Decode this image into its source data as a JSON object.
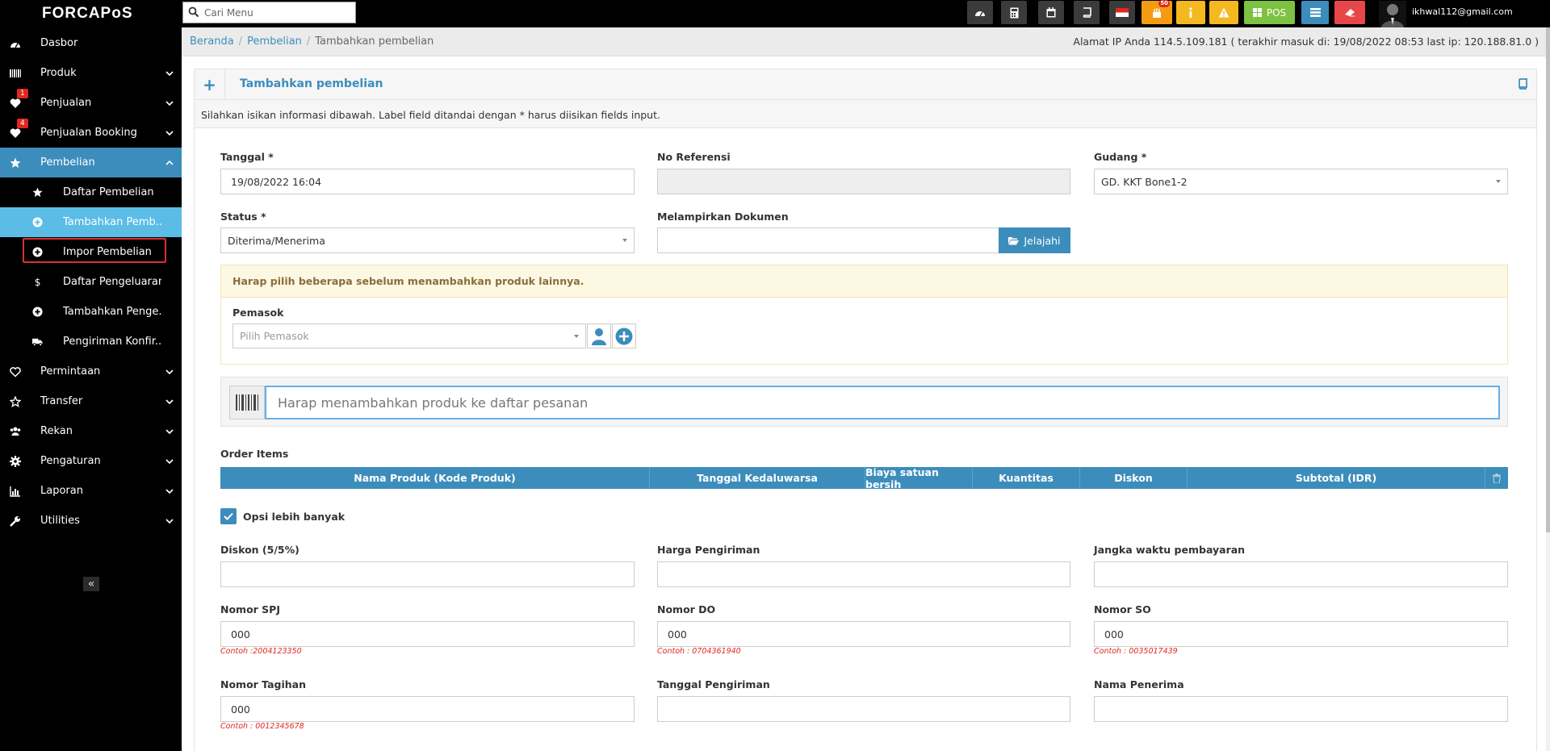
{
  "app": {
    "logo": "FORCAPoS"
  },
  "topbar": {
    "search_placeholder": "Cari Menu",
    "notification_count": "50",
    "pos_label": "POS",
    "user_email": "ikhwal112@gmail.com",
    "colors": {
      "orange": "#f39c12",
      "yellow": "#f5b821",
      "green": "#7dc242",
      "blue": "#3c8dbc",
      "red": "#e8474a"
    }
  },
  "sidebar": {
    "items": [
      {
        "label": "Dasbor",
        "icon": "dashboard-icon"
      },
      {
        "label": "Produk",
        "icon": "barcode-icon"
      },
      {
        "label": "Penjualan",
        "icon": "heart-icon",
        "badge": "1"
      },
      {
        "label": "Penjualan Booking",
        "icon": "heart-icon",
        "badge": "4"
      },
      {
        "label": "Pembelian",
        "icon": "star-icon"
      },
      {
        "label": "Permintaan",
        "icon": "heart-outline-icon"
      },
      {
        "label": "Transfer",
        "icon": "star-outline-icon"
      },
      {
        "label": "Rekan",
        "icon": "users-icon"
      },
      {
        "label": "Pengaturan",
        "icon": "gear-icon"
      },
      {
        "label": "Laporan",
        "icon": "bar-chart-icon"
      },
      {
        "label": "Utilities",
        "icon": "wrench-icon"
      }
    ],
    "subitems": [
      {
        "label": "Daftar Pembelian",
        "icon": "star-icon"
      },
      {
        "label": "Tambahkan Pemb...",
        "icon": "plus-circle-icon"
      },
      {
        "label": "Impor Pembelian",
        "icon": "plus-circle-icon"
      },
      {
        "label": "Daftar Pengeluaran",
        "icon": "dollar-icon"
      },
      {
        "label": "Tambahkan Penge...",
        "icon": "plus-circle-icon"
      },
      {
        "label": "Pengiriman Konfir...",
        "icon": "truck-icon"
      }
    ],
    "collapse_label": "«"
  },
  "breadcrumb": {
    "home": "Beranda",
    "parent": "Pembelian",
    "current": "Tambahkan pembelian",
    "sep": "/"
  },
  "ip_info": "Alamat IP Anda 114.5.109.181 ( terakhir masuk di: 19/08/2022 08:53 last ip: 120.188.81.0 )",
  "box": {
    "title": "Tambahkan pembelian",
    "intro": "Silahkan isikan informasi dibawah. Label field ditandai dengan * harus diisikan fields input."
  },
  "form": {
    "tanggal": {
      "label": "Tanggal *",
      "value": "19/08/2022 16:04"
    },
    "no_referensi": {
      "label": "No Referensi",
      "value": ""
    },
    "gudang": {
      "label": "Gudang *",
      "value": "GD. KKT Bone1-2"
    },
    "status": {
      "label": "Status *",
      "value": "Diterima/Menerima"
    },
    "dokumen": {
      "label": "Melampirkan Dokumen",
      "button": "Jelajahi"
    },
    "warning": "Harap pilih beberapa sebelum menambahkan produk lainnya.",
    "pemasok": {
      "label": "Pemasok",
      "placeholder": "Pilih Pemasok"
    },
    "scan_placeholder": "Harap menambahkan produk ke daftar pesanan",
    "order_items_label": "Order Items",
    "columns": [
      "Nama Produk (Kode Produk)",
      "Tanggal Kedaluwarsa",
      "Biaya satuan bersih",
      "Kuantitas",
      "Diskon",
      "Subtotal (IDR)"
    ],
    "more_options": "Opsi lebih banyak",
    "diskon": {
      "label": "Diskon (5/5%)",
      "value": ""
    },
    "harga_pengiriman": {
      "label": "Harga Pengiriman",
      "value": ""
    },
    "jangka_waktu": {
      "label": "Jangka waktu pembayaran",
      "value": ""
    },
    "nomor_spj": {
      "label": "Nomor SPJ",
      "value": "000",
      "hint": "Contoh :2004123350"
    },
    "nomor_do": {
      "label": "Nomor DO",
      "value": "000",
      "hint": "Contoh : 0704361940"
    },
    "nomor_so": {
      "label": "Nomor SO",
      "value": "000",
      "hint": "Contoh : 0035017439"
    },
    "nomor_tagihan": {
      "label": "Nomor Tagihan",
      "value": "000",
      "hint": "Contoh : 0012345678"
    },
    "tanggal_pengiriman": {
      "label": "Tanggal Pengiriman",
      "value": ""
    },
    "nama_penerima": {
      "label": "Nama Penerima",
      "value": ""
    }
  }
}
